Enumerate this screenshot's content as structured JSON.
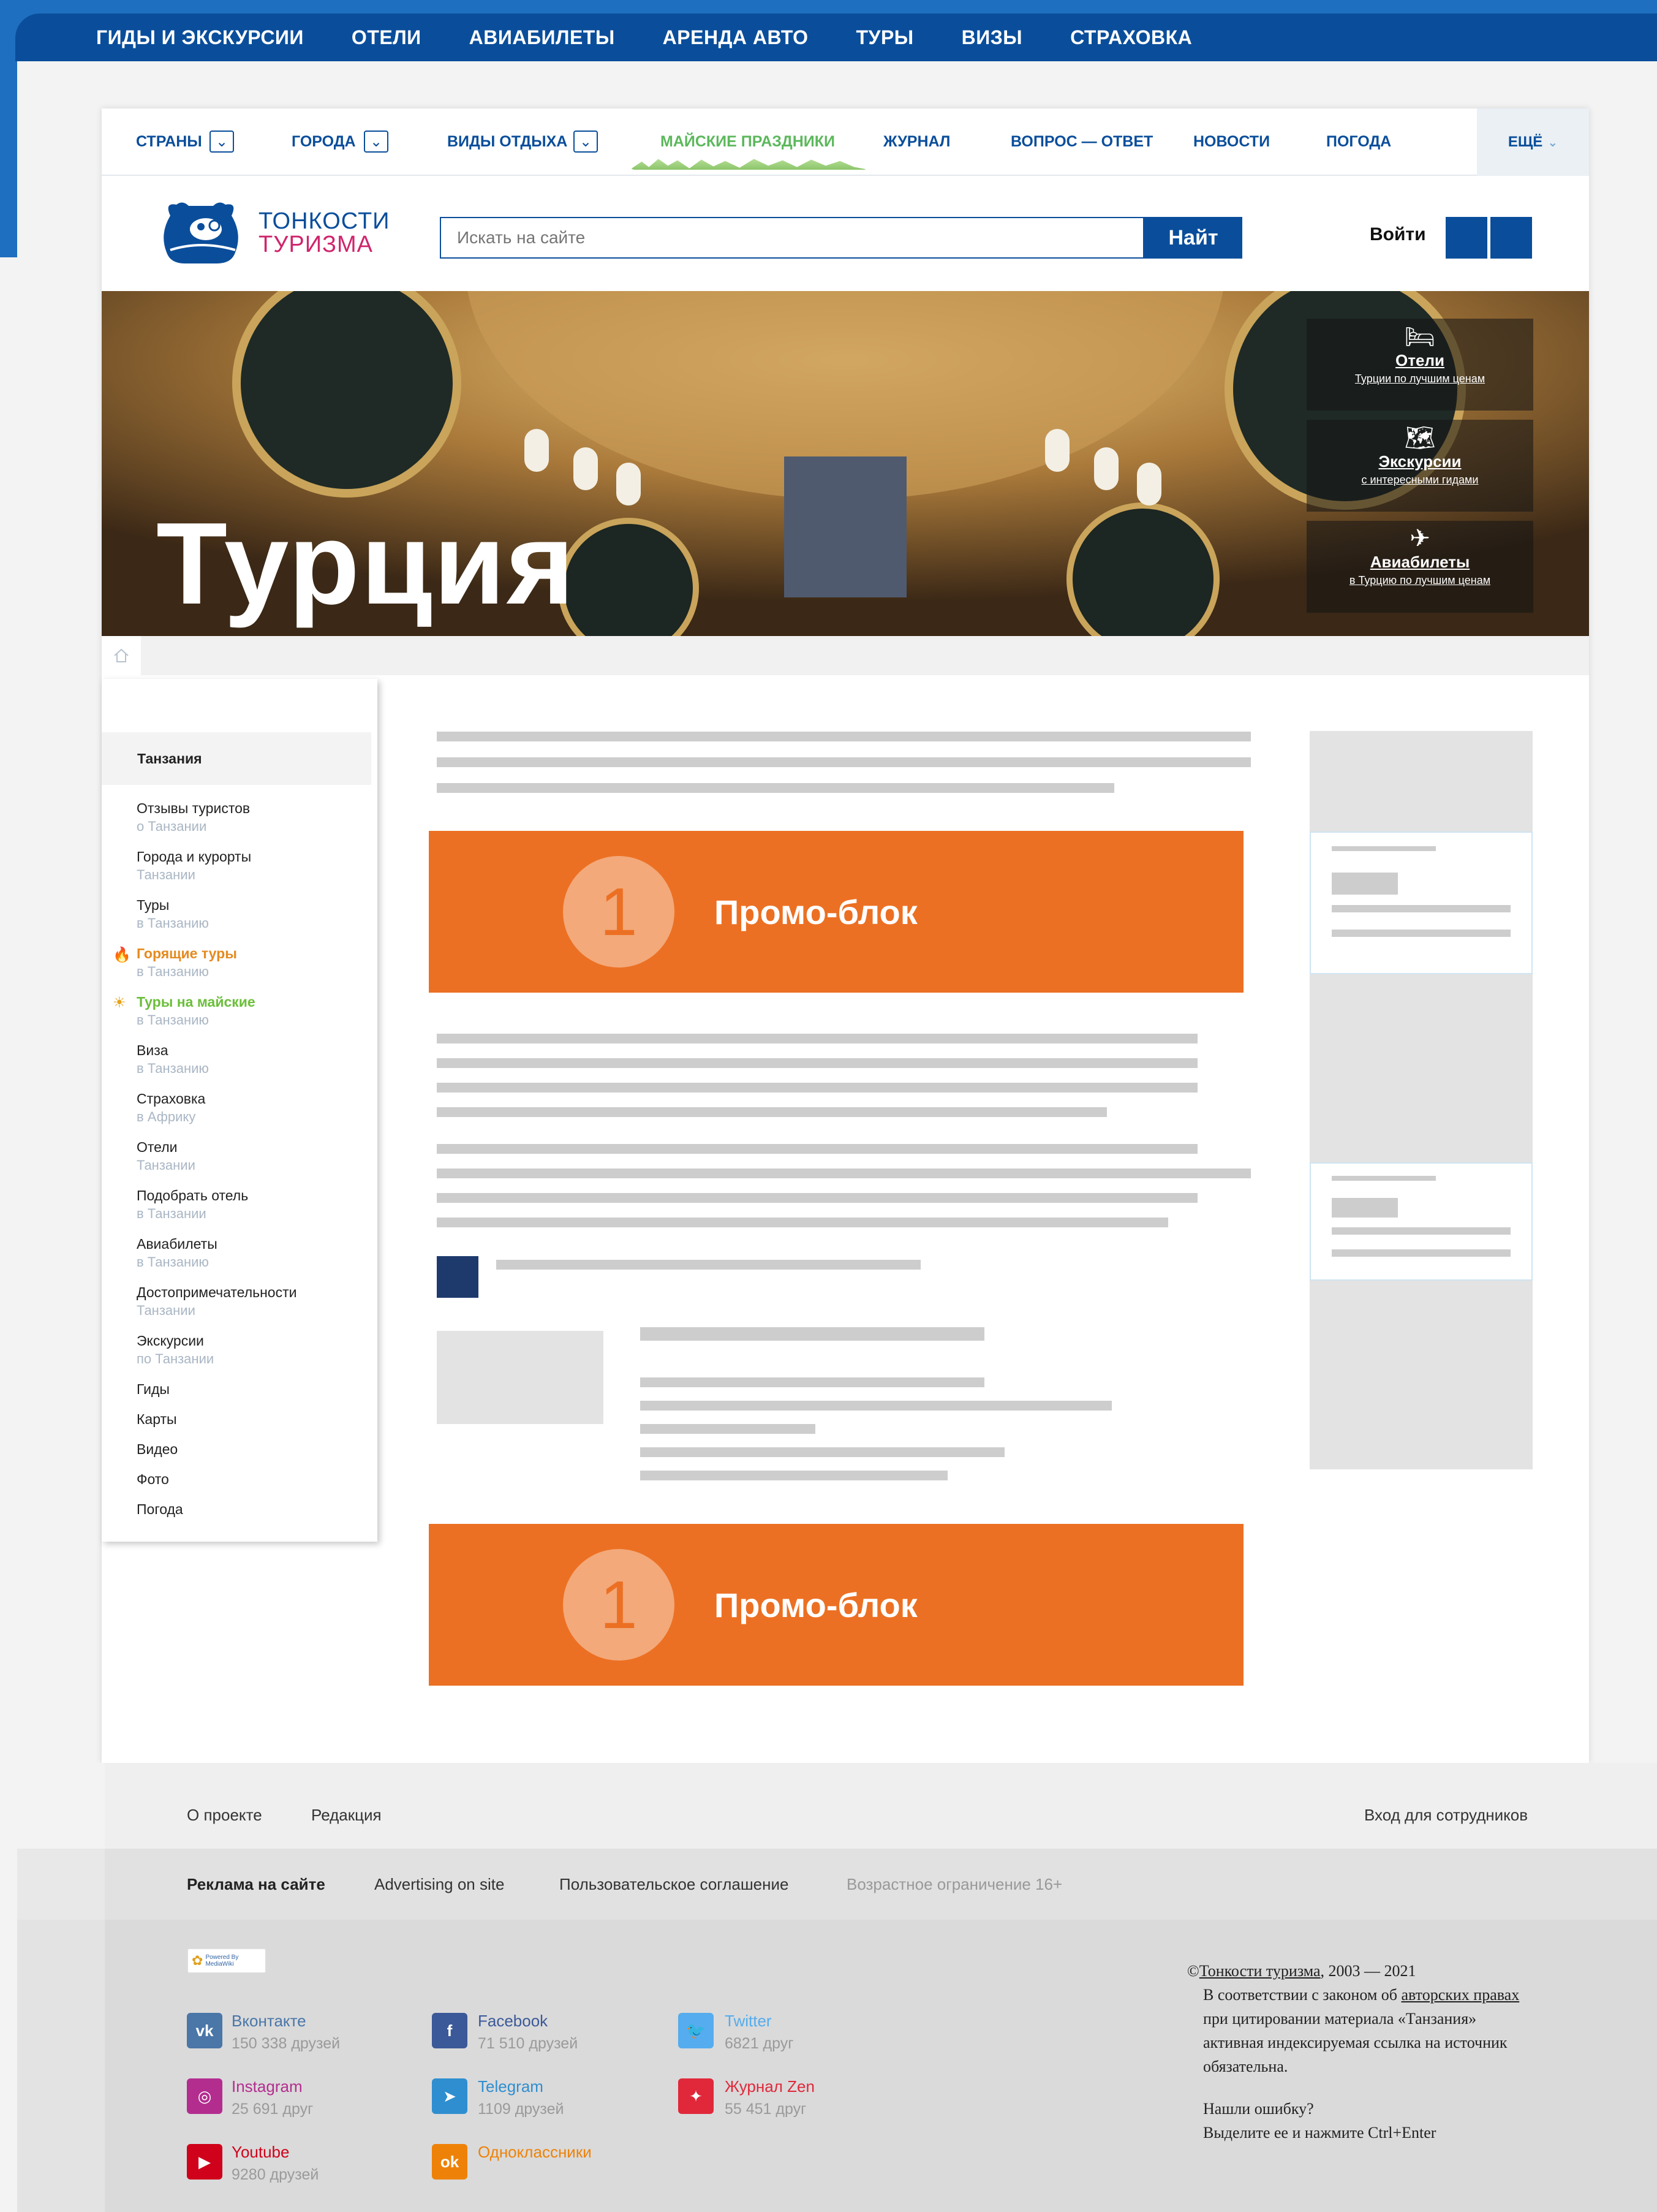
{
  "colors": {
    "brand_blue": "#0a4e9b",
    "promo_orange": "#ec7023",
    "accent_green": "#5cb85c",
    "accent_pink": "#d0246c"
  },
  "topnav": [
    "ГИДЫ И ЭКСКУРСИИ",
    "ОТЕЛИ",
    "АВИАБИЛЕТЫ",
    "АРЕНДА АВТО",
    "ТУРЫ",
    "ВИЗЫ",
    "СТРАХОВКА"
  ],
  "subnav": {
    "countries": "СТРАНЫ",
    "cities": "ГОРОДА",
    "types": "ВИДЫ ОТДЫХА",
    "holidays": "МАЙСКИЕ ПРАЗДНИКИ",
    "journal": "ЖУРНАЛ",
    "qa": "ВОПРОС — ОТВЕТ",
    "news": "НОВОСТИ",
    "weather": "ПОГОДА",
    "more": "ЕЩЁ"
  },
  "logo": {
    "line1": "ТОНКОСТИ",
    "line2": "ТУРИЗМА"
  },
  "search": {
    "placeholder": "Искать на сайте",
    "button": "Найт"
  },
  "login": "Войти",
  "hero": {
    "title": "Турция",
    "links": [
      {
        "icon": "bed-icon",
        "title": "Отели",
        "subtitle": "Турции по лучшим ценам"
      },
      {
        "icon": "map-icon",
        "title": "Экскурсии",
        "subtitle": "с интересными гидами"
      },
      {
        "icon": "plane-icon",
        "title": "Авиабилеты",
        "subtitle": "в Турцию по лучшим ценам"
      }
    ]
  },
  "sidebar": {
    "heading": "Танзания",
    "items": [
      {
        "label": "Отзывы туристов",
        "sub": "о Танзании"
      },
      {
        "label": "Города и курорты",
        "sub": "Танзании"
      },
      {
        "label": "Туры",
        "sub": "в Танзанию"
      },
      {
        "label": "Горящие туры",
        "sub": "в Танзанию"
      },
      {
        "label": "Туры на майские",
        "sub": "в Танзанию"
      },
      {
        "label": "Виза",
        "sub": "в Танзанию"
      },
      {
        "label": "Страховка",
        "sub": "в Африку"
      },
      {
        "label": "Отели",
        "sub": "Танзании"
      },
      {
        "label": "Подобрать отель",
        "sub": "в Танзании"
      },
      {
        "label": "Авиабилеты",
        "sub": "в Танзанию"
      },
      {
        "label": "Достопримечательности",
        "sub": "Танзании"
      },
      {
        "label": "Экскурсии",
        "sub": "по Танзании"
      },
      {
        "label": "Гиды"
      },
      {
        "label": "Карты"
      },
      {
        "label": "Видео"
      },
      {
        "label": "Фото"
      },
      {
        "label": "Погода"
      }
    ]
  },
  "promo": {
    "number": "1",
    "text": "Промо-блок"
  },
  "footer": {
    "about": "О проекте",
    "editorial": "Редакция",
    "staff": "Вход для сотрудников",
    "ads": "Реклама на сайте",
    "ads_en": "Advertising on site",
    "agreement": "Пользовательское соглашение",
    "age": "Возрастное ограничение 16+",
    "mediawiki": "Powered By MediaWiki",
    "social": [
      {
        "icon": "vk-icon",
        "name": "Вконтакте",
        "count": "150 338 друзей",
        "color": "#4a76a8"
      },
      {
        "icon": "facebook-icon",
        "name": "Facebook",
        "count": "71 510 друзей",
        "color": "#3b5998"
      },
      {
        "icon": "twitter-icon",
        "name": "Twitter",
        "count": "6821 друг",
        "color": "#55acee"
      },
      {
        "icon": "instagram-icon",
        "name": "Instagram",
        "count": "25 691 друг",
        "color": "#b32d8f"
      },
      {
        "icon": "telegram-icon",
        "name": "Telegram",
        "count": "1109 друзей",
        "color": "#2f8ed0"
      },
      {
        "icon": "zen-icon",
        "name": "Журнал Zen",
        "count": "55 451 друг",
        "color": "#e0283a"
      },
      {
        "icon": "youtube-icon",
        "name": "Youtube",
        "count": "9280 друзей",
        "color": "#d0021b"
      },
      {
        "icon": "ok-icon",
        "name": "Одноклассники",
        "count": "",
        "color": "#ee8208"
      }
    ],
    "copyright": {
      "sign": "©",
      "site": "Тонкости туризма",
      "years": ", 2003 — 2021",
      "p1a": "В соответствии с законом об ",
      "p1link": "авторских правах",
      "p1b": " при цитировании материала «Танзания» активная индексируемая ссылка на источник обязательна.",
      "err1": "Нашли ошибку?",
      "err2": "Выделите ее и нажмите Ctrl+Enter"
    }
  }
}
